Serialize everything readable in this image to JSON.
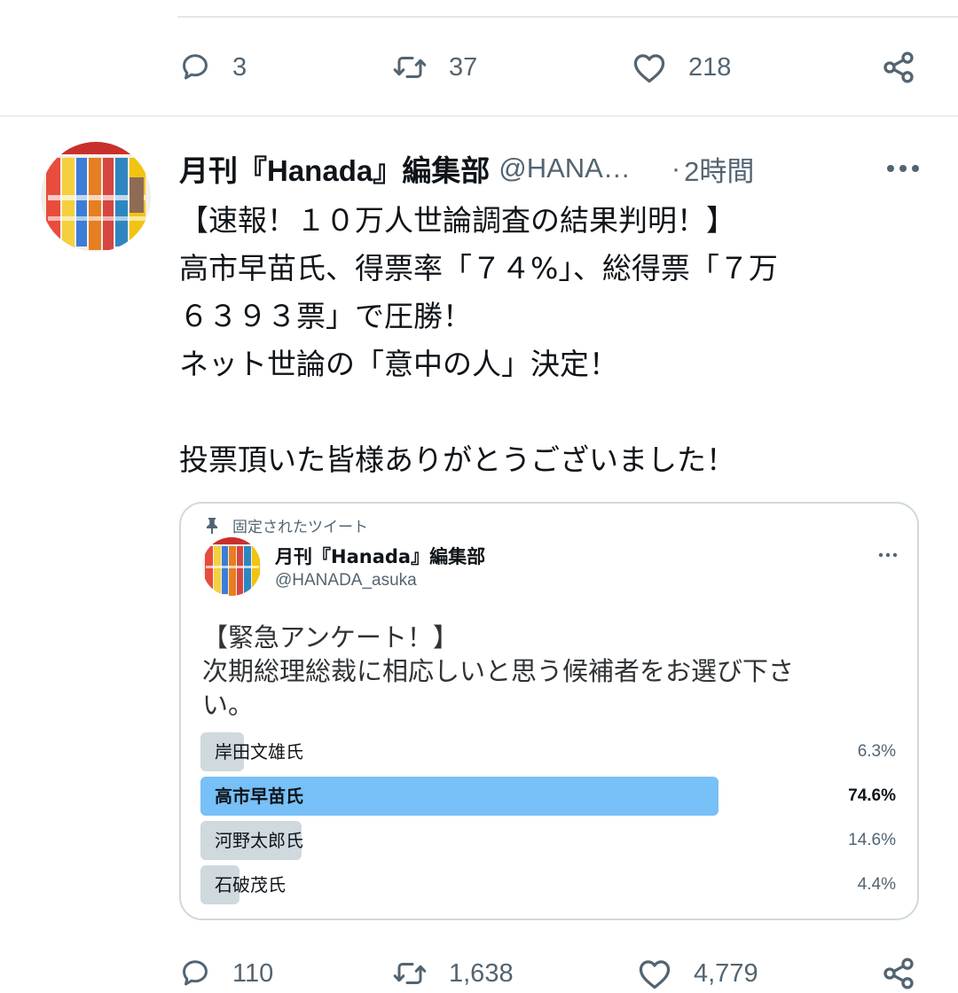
{
  "prev_tweet": {
    "actions": {
      "reply_count": "3",
      "retweet_count": "37",
      "like_count": "218"
    }
  },
  "tweet": {
    "display_name": "月刊『Hanada』編集部",
    "handle": "@HANA…",
    "separator": "·",
    "time": "2時間",
    "text_lines": [
      "【速報！１０万人世論調査の結果判明！】",
      "高市早苗氏、得票率「７４%」、総得票「７万",
      "６３９３票」で圧勝！",
      "ネット世論の「意中の人」決定！",
      "",
      "投票頂いた皆様ありがとうございました！"
    ],
    "actions": {
      "reply_count": "110",
      "retweet_count": "1,638",
      "like_count": "4,779"
    }
  },
  "quoted": {
    "pinned_label": "固定されたツイート",
    "display_name": "月刊『Hanada』編集部",
    "handle": "@HANADA_asuka",
    "text_lines": [
      "【緊急アンケート！】",
      "次期総理総裁に相応しいと思う候補者をお選び下さ",
      "い。"
    ],
    "poll": [
      {
        "label": "岸田文雄氏",
        "percent_text": "6.3%",
        "percent": 6.3,
        "winner": false
      },
      {
        "label": "高市早苗氏",
        "percent_text": "74.6%",
        "percent": 74.6,
        "winner": true
      },
      {
        "label": "河野太郎氏",
        "percent_text": "14.6%",
        "percent": 14.6,
        "winner": false
      },
      {
        "label": "石破茂氏",
        "percent_text": "4.4%",
        "percent": 4.4,
        "winner": false
      }
    ]
  },
  "icons": [
    "reply-icon",
    "retweet-icon",
    "like-icon",
    "share-icon",
    "more-icon",
    "pin-icon"
  ],
  "colors": {
    "text": "#0f1419",
    "secondary": "#536471",
    "border": "#cfd9de",
    "poll_winner": "#77c0f8",
    "poll_other": "#cfd9de"
  }
}
